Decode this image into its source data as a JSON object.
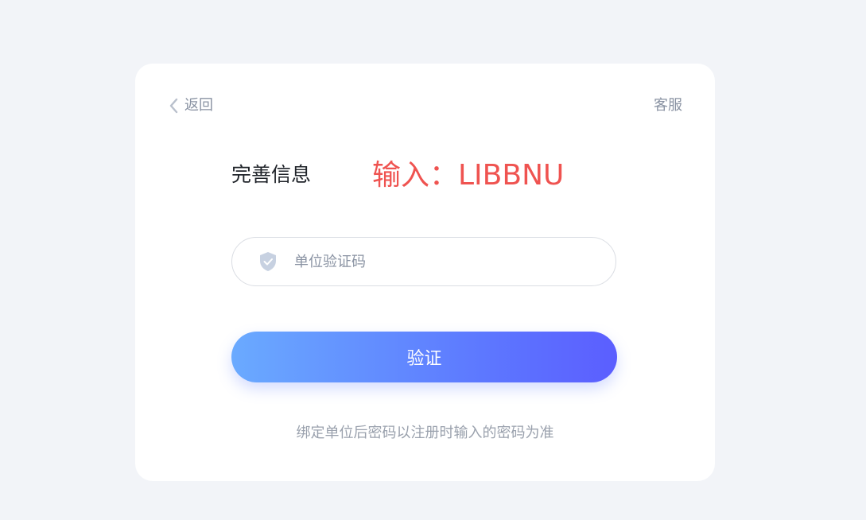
{
  "header": {
    "back_label": "返回",
    "service_label": "客服"
  },
  "main": {
    "title": "完善信息",
    "hint": "输入：LIBBNU",
    "hint_color": "#ef5350"
  },
  "form": {
    "code_placeholder": "单位验证码",
    "code_value": "",
    "field_icon": "shield-check-icon",
    "verify_label": "验证",
    "button_gradient": [
      "#6aaaff",
      "#5b5eff"
    ]
  },
  "footer": {
    "note": "绑定单位后密码以注册时输入的密码为准"
  }
}
